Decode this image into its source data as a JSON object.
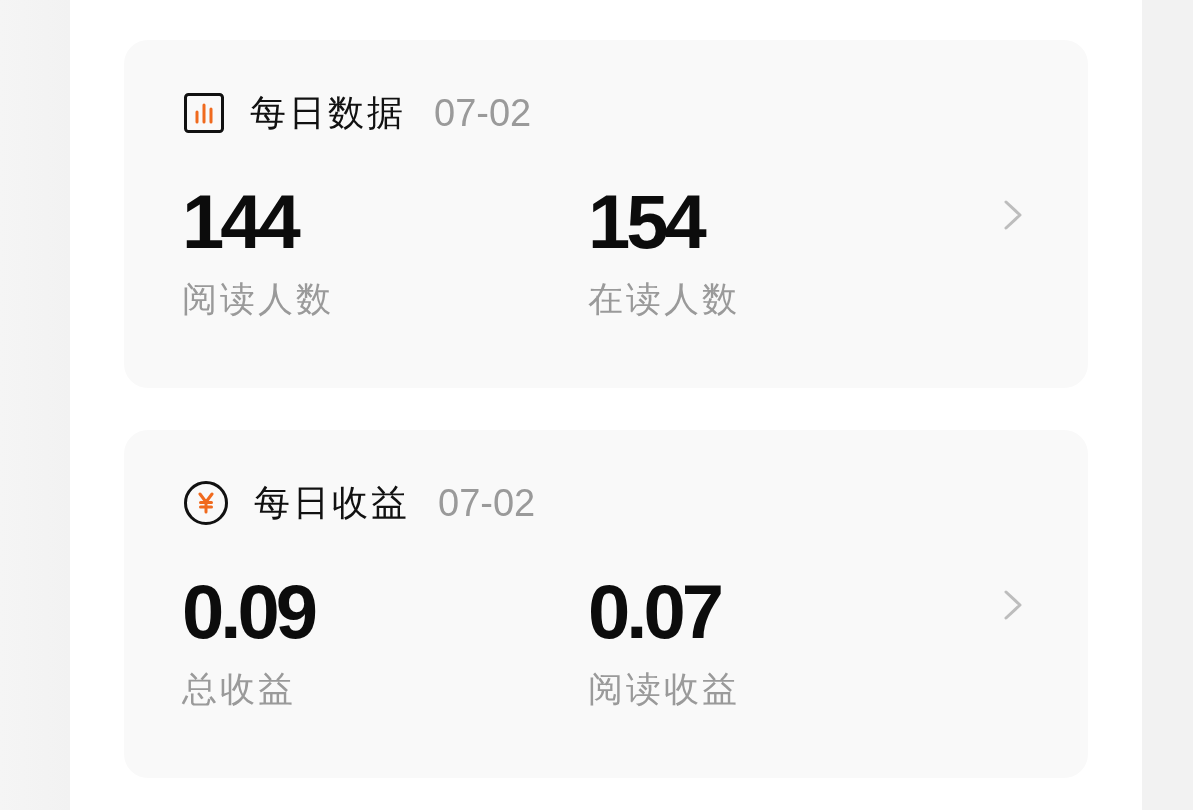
{
  "cards": [
    {
      "kind": "chart",
      "title": "每日数据",
      "date": "07-02",
      "stats": [
        {
          "value": "144",
          "label": "阅读人数"
        },
        {
          "value": "154",
          "label": "在读人数"
        }
      ]
    },
    {
      "kind": "yen",
      "title": "每日收益",
      "date": "07-02",
      "stats": [
        {
          "value": "0.09",
          "label": "总收益"
        },
        {
          "value": "0.07",
          "label": "阅读收益"
        }
      ]
    }
  ]
}
